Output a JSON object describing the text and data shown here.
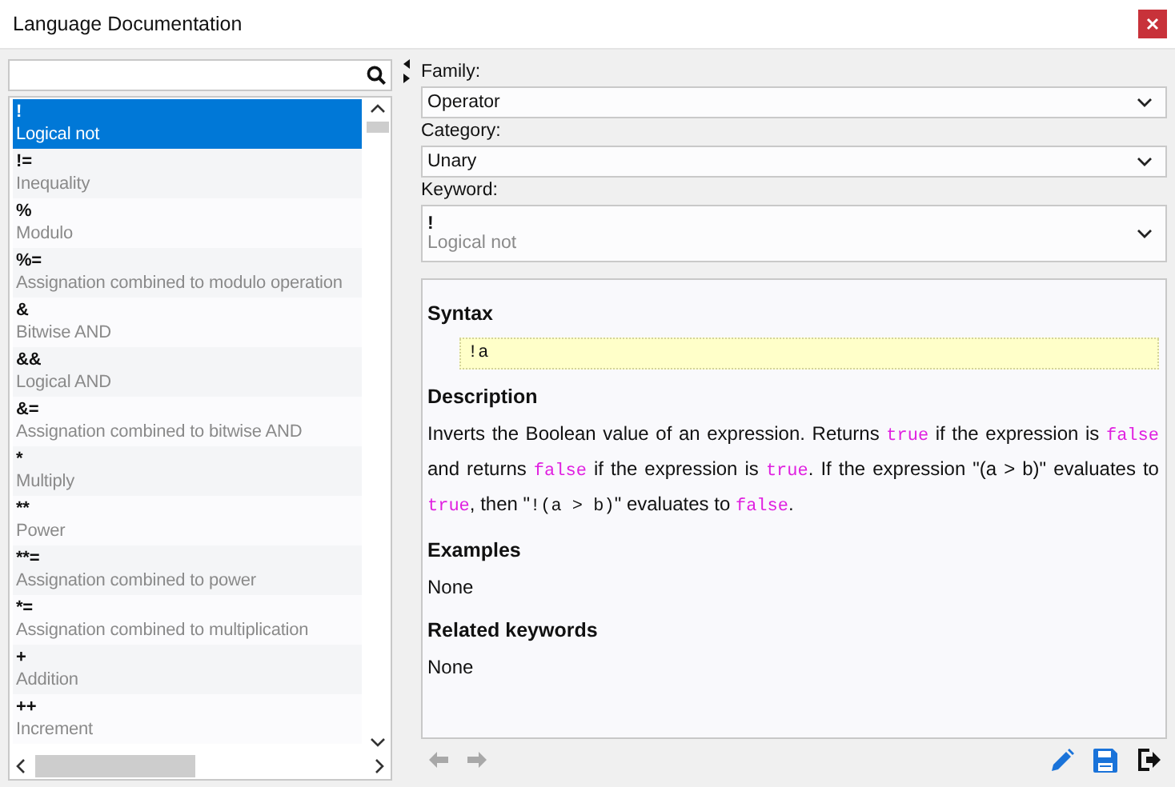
{
  "window": {
    "title": "Language Documentation"
  },
  "keywords": [
    {
      "symbol": "!",
      "description": "Logical not",
      "selected": true
    },
    {
      "symbol": "!=",
      "description": "Inequality",
      "selected": false
    },
    {
      "symbol": "%",
      "description": "Modulo",
      "selected": false
    },
    {
      "symbol": "%=",
      "description": "Assignation combined to modulo operation",
      "selected": false
    },
    {
      "symbol": "&",
      "description": "Bitwise AND",
      "selected": false
    },
    {
      "symbol": "&&",
      "description": "Logical AND",
      "selected": false
    },
    {
      "symbol": "&=",
      "description": "Assignation combined to bitwise AND",
      "selected": false
    },
    {
      "symbol": "*",
      "description": "Multiply",
      "selected": false
    },
    {
      "symbol": "**",
      "description": "Power",
      "selected": false
    },
    {
      "symbol": "**=",
      "description": "Assignation combined to power",
      "selected": false
    },
    {
      "symbol": "*=",
      "description": "Assignation combined to multiplication",
      "selected": false
    },
    {
      "symbol": "+",
      "description": "Addition",
      "selected": false
    },
    {
      "symbol": "++",
      "description": "Increment",
      "selected": false
    }
  ],
  "family": {
    "label": "Family:",
    "value": "Operator"
  },
  "category": {
    "label": "Category:",
    "value": "Unary"
  },
  "keyword": {
    "label": "Keyword:",
    "symbol": "!",
    "description": "Logical not"
  },
  "documentation": [
    {
      "heading": "Syntax",
      "kind": "code",
      "code": "!a"
    },
    {
      "heading": "Description",
      "kind": "segments",
      "segments": [
        {
          "kind": "text",
          "text": "Inverts the Boolean value of an expression. Returns "
        },
        {
          "kind": "keyword",
          "text": "true"
        },
        {
          "kind": "text",
          "text": " if the expression is "
        },
        {
          "kind": "keyword",
          "text": "false"
        },
        {
          "kind": "text",
          "text": " and returns "
        },
        {
          "kind": "keyword",
          "text": "false"
        },
        {
          "kind": "text",
          "text": " if the expression is "
        },
        {
          "kind": "keyword",
          "text": "true"
        },
        {
          "kind": "text",
          "text": ". If the expression \"(a > b)\" evaluates to "
        },
        {
          "kind": "keyword",
          "text": "true"
        },
        {
          "kind": "text",
          "text": ", then \""
        },
        {
          "kind": "code",
          "text": "!(a > b)"
        },
        {
          "kind": "text",
          "text": "\" evaluates to "
        },
        {
          "kind": "keyword",
          "text": "false"
        },
        {
          "kind": "text",
          "text": "."
        }
      ]
    },
    {
      "heading": "Examples",
      "kind": "text",
      "text": "None"
    },
    {
      "heading": "Related keywords",
      "kind": "text",
      "text": "None"
    }
  ],
  "navigation": [
    {
      "kind": "back",
      "disabled": true
    },
    {
      "kind": "forward",
      "disabled": true
    }
  ],
  "actions": [
    {
      "kind": "edit"
    },
    {
      "kind": "save"
    },
    {
      "kind": "exit"
    }
  ]
}
